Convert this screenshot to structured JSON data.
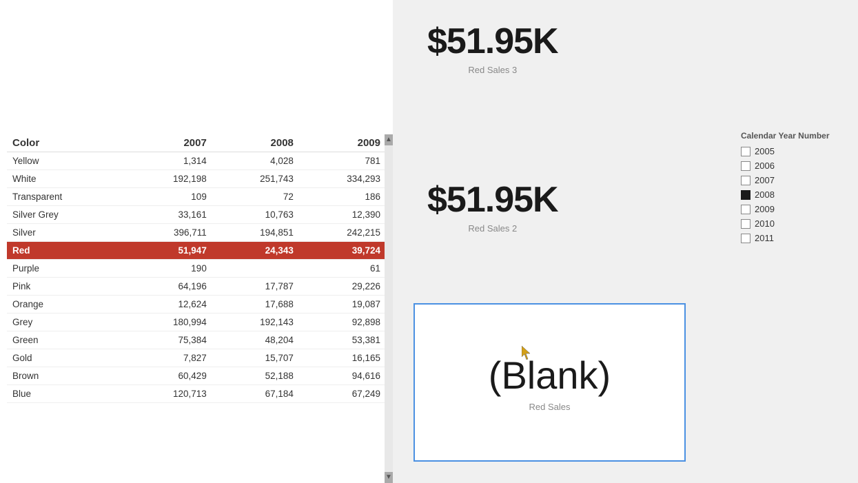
{
  "table": {
    "headers": {
      "color": "Color",
      "y2007": "2007",
      "y2008": "2008",
      "y2009": "2009"
    },
    "rows": [
      {
        "color": "Yellow",
        "y2007": "1,314",
        "y2008": "4,028",
        "y2009": "781",
        "highlighted": false
      },
      {
        "color": "White",
        "y2007": "192,198",
        "y2008": "251,743",
        "y2009": "334,293",
        "highlighted": false
      },
      {
        "color": "Transparent",
        "y2007": "109",
        "y2008": "72",
        "y2009": "186",
        "highlighted": false
      },
      {
        "color": "Silver Grey",
        "y2007": "33,161",
        "y2008": "10,763",
        "y2009": "12,390",
        "highlighted": false
      },
      {
        "color": "Silver",
        "y2007": "396,711",
        "y2008": "194,851",
        "y2009": "242,215",
        "highlighted": false
      },
      {
        "color": "Red",
        "y2007": "51,947",
        "y2008": "24,343",
        "y2009": "39,724",
        "highlighted": true
      },
      {
        "color": "Purple",
        "y2007": "190",
        "y2008": "",
        "y2009": "61",
        "highlighted": false
      },
      {
        "color": "Pink",
        "y2007": "64,196",
        "y2008": "17,787",
        "y2009": "29,226",
        "highlighted": false
      },
      {
        "color": "Orange",
        "y2007": "12,624",
        "y2008": "17,688",
        "y2009": "19,087",
        "highlighted": false
      },
      {
        "color": "Grey",
        "y2007": "180,994",
        "y2008": "192,143",
        "y2009": "92,898",
        "highlighted": false
      },
      {
        "color": "Green",
        "y2007": "75,384",
        "y2008": "48,204",
        "y2009": "53,381",
        "highlighted": false
      },
      {
        "color": "Gold",
        "y2007": "7,827",
        "y2008": "15,707",
        "y2009": "16,165",
        "highlighted": false
      },
      {
        "color": "Brown",
        "y2007": "60,429",
        "y2008": "52,188",
        "y2009": "94,616",
        "highlighted": false
      },
      {
        "color": "Blue",
        "y2007": "120,713",
        "y2008": "67,184",
        "y2009": "67,249",
        "highlighted": false
      }
    ]
  },
  "kpi1": {
    "value": "$51.95K",
    "label": "Red Sales 3"
  },
  "kpi2": {
    "value": "$51.95K",
    "label": "Red Sales 2"
  },
  "blank_card": {
    "value": "(Blank)",
    "label": "Red Sales"
  },
  "legend": {
    "title": "Calendar Year Number",
    "items": [
      {
        "year": "2005",
        "checked": false
      },
      {
        "year": "2006",
        "checked": false
      },
      {
        "year": "2007",
        "checked": false
      },
      {
        "year": "2008",
        "checked": true
      },
      {
        "year": "2009",
        "checked": false
      },
      {
        "year": "2010",
        "checked": false
      },
      {
        "year": "2011",
        "checked": false
      }
    ]
  }
}
